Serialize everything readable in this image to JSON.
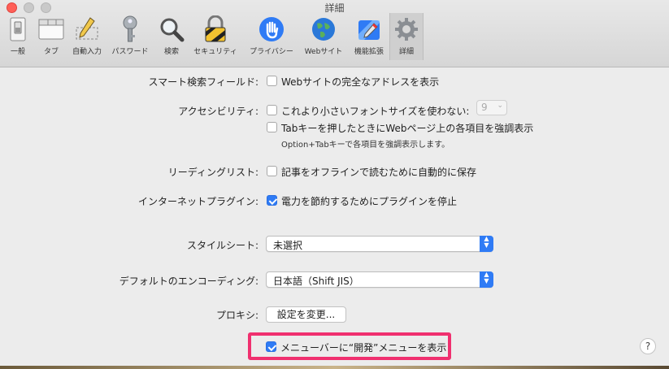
{
  "window": {
    "title": "詳細"
  },
  "toolbar": [
    {
      "label": "一般",
      "icon": "switch-icon"
    },
    {
      "label": "タブ",
      "icon": "tabs-icon"
    },
    {
      "label": "自動入力",
      "icon": "pencil-icon"
    },
    {
      "label": "パスワード",
      "icon": "key-icon"
    },
    {
      "label": "検索",
      "icon": "magnifier-icon"
    },
    {
      "label": "セキュリティ",
      "icon": "lock-icon"
    },
    {
      "label": "プライバシー",
      "icon": "hand-icon"
    },
    {
      "label": "Webサイト",
      "icon": "globe-icon"
    },
    {
      "label": "機能拡張",
      "icon": "puzzle-icon"
    },
    {
      "label": "詳細",
      "icon": "gear-icon"
    }
  ],
  "settings": {
    "smart_search": {
      "label": "スマート検索フィールド:",
      "option": "Webサイトの完全なアドレスを表示",
      "checked": false
    },
    "accessibility": {
      "label": "アクセシビリティ:",
      "font_option": "これより小さいフォントサイズを使わない:",
      "font_checked": false,
      "font_size": "9",
      "tab_option": "Tabキーを押したときにWebページ上の各項目を強調表示",
      "tab_checked": false,
      "tab_hint": "Option+Tabキーで各項目を強調表示します。"
    },
    "reading_list": {
      "label": "リーディングリスト:",
      "option": "記事をオフラインで読むために自動的に保存",
      "checked": false
    },
    "plugins": {
      "label": "インターネットプラグイン:",
      "option": "電力を節約するためにプラグインを停止",
      "checked": true
    },
    "stylesheet": {
      "label": "スタイルシート:",
      "value": "未選択"
    },
    "encoding": {
      "label": "デフォルトのエンコーディング:",
      "value": "日本語（Shift JIS）"
    },
    "proxy": {
      "label": "プロキシ:",
      "button": "設定を変更..."
    },
    "develop_menu": {
      "option": "メニューバーに“開発”メニューを表示",
      "checked": true
    }
  },
  "help_label": "?",
  "colors": {
    "accent": "#2f7bf5",
    "highlight": "#f0306f"
  }
}
